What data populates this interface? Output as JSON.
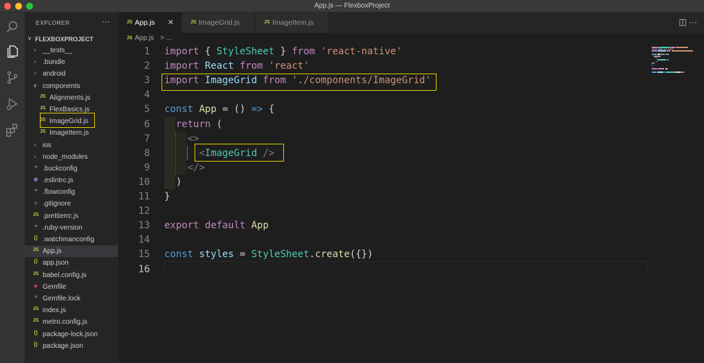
{
  "window": {
    "title": "App.js — FlexboxProject"
  },
  "sidebar": {
    "title": "EXPLORER",
    "more": "···",
    "project": "FLEXBOXPROJECT",
    "items": [
      {
        "label": "__tests__",
        "type": "folder",
        "expanded": false,
        "depth": 0,
        "icon": "chevron-right-icon"
      },
      {
        "label": ".bundle",
        "type": "folder",
        "expanded": false,
        "depth": 0,
        "icon": "chevron-right-icon"
      },
      {
        "label": "android",
        "type": "folder",
        "expanded": false,
        "depth": 0,
        "icon": "chevron-right-icon"
      },
      {
        "label": "components",
        "type": "folder",
        "expanded": true,
        "depth": 0,
        "icon": "chevron-down-icon"
      },
      {
        "label": "Alignments.js",
        "type": "file",
        "depth": 1,
        "badge": "JS",
        "badge_color": "#cbcb41"
      },
      {
        "label": "FlexBasics.js",
        "type": "file",
        "depth": 1,
        "badge": "JS",
        "badge_color": "#cbcb41"
      },
      {
        "label": "ImageGrid.js",
        "type": "file",
        "depth": 1,
        "badge": "JS",
        "badge_color": "#cbcb41"
      },
      {
        "label": "ImageItem.js",
        "type": "file",
        "depth": 1,
        "badge": "JS",
        "badge_color": "#cbcb41"
      },
      {
        "label": "ios",
        "type": "folder",
        "expanded": false,
        "depth": 0,
        "icon": "chevron-right-icon"
      },
      {
        "label": "node_modules",
        "type": "folder",
        "expanded": false,
        "depth": 0,
        "icon": "chevron-right-icon"
      },
      {
        "label": ".buckconfig",
        "type": "file",
        "depth": 0,
        "badge": "≡",
        "badge_color": "#9da5b4"
      },
      {
        "label": ".eslintrc.js",
        "type": "file",
        "depth": 0,
        "badge": "◉",
        "badge_color": "#a074c4"
      },
      {
        "label": ".flowconfig",
        "type": "file",
        "depth": 0,
        "badge": "≡",
        "badge_color": "#9da5b4"
      },
      {
        "label": ".gitignore",
        "type": "file",
        "depth": 0,
        "badge": "◆",
        "badge_color": "#41535b"
      },
      {
        "label": ".prettierrc.js",
        "type": "file",
        "depth": 0,
        "badge": "JS",
        "badge_color": "#cbcb41"
      },
      {
        "label": ".ruby-version",
        "type": "file",
        "depth": 0,
        "badge": "≡",
        "badge_color": "#9da5b4"
      },
      {
        "label": ".watchmanconfig",
        "type": "file",
        "depth": 0,
        "badge": "{}",
        "badge_color": "#cbcb41"
      },
      {
        "label": "App.js",
        "type": "file",
        "depth": 0,
        "badge": "JS",
        "badge_color": "#cbcb41",
        "active": true
      },
      {
        "label": "app.json",
        "type": "file",
        "depth": 0,
        "badge": "{}",
        "badge_color": "#cbcb41"
      },
      {
        "label": "babel.config.js",
        "type": "file",
        "depth": 0,
        "badge": "JS",
        "badge_color": "#cbcb41"
      },
      {
        "label": "Gemfile",
        "type": "file",
        "depth": 0,
        "badge": "◆",
        "badge_color": "#cc3e44"
      },
      {
        "label": "Gemfile.lock",
        "type": "file",
        "depth": 0,
        "badge": "≡",
        "badge_color": "#9da5b4"
      },
      {
        "label": "index.js",
        "type": "file",
        "depth": 0,
        "badge": "JS",
        "badge_color": "#cbcb41"
      },
      {
        "label": "metro.config.js",
        "type": "file",
        "depth": 0,
        "badge": "JS",
        "badge_color": "#cbcb41"
      },
      {
        "label": "package-lock.json",
        "type": "file",
        "depth": 0,
        "badge": "{}",
        "badge_color": "#cbcb41"
      },
      {
        "label": "package.json",
        "type": "file",
        "depth": 0,
        "badge": "{}",
        "badge_color": "#cbcb41"
      }
    ]
  },
  "tabs": [
    {
      "label": "App.js",
      "icon": "JS",
      "active": true,
      "close": "✕"
    },
    {
      "label": "ImageGrid.js",
      "icon": "JS",
      "active": false
    },
    {
      "label": "ImageItem.js",
      "icon": "JS",
      "active": false
    }
  ],
  "tab_actions": "◫  ···",
  "breadcrumb": {
    "icon": "JS",
    "file": "App.js",
    "sep": "> ..."
  },
  "editor": {
    "current_line": 16,
    "lines": [
      {
        "n": "1",
        "tokens": [
          [
            "kw",
            "import"
          ],
          [
            "pn",
            " { "
          ],
          [
            "cls",
            "StyleSheet"
          ],
          [
            "pn",
            " } "
          ],
          [
            "kw",
            "from"
          ],
          [
            "pn",
            " "
          ],
          [
            "str",
            "'react-native'"
          ]
        ]
      },
      {
        "n": "2",
        "tokens": [
          [
            "kw",
            "import"
          ],
          [
            "pn",
            " "
          ],
          [
            "vr",
            "React"
          ],
          [
            "pn",
            " "
          ],
          [
            "kw",
            "from"
          ],
          [
            "pn",
            " "
          ],
          [
            "str",
            "'react'"
          ]
        ]
      },
      {
        "n": "3",
        "tokens": [
          [
            "kw",
            "import"
          ],
          [
            "pn",
            " "
          ],
          [
            "vr",
            "ImageGrid"
          ],
          [
            "pn",
            " "
          ],
          [
            "kw",
            "from"
          ],
          [
            "pn",
            " "
          ],
          [
            "str",
            "'./components/ImageGrid'"
          ]
        ]
      },
      {
        "n": "4",
        "tokens": []
      },
      {
        "n": "5",
        "tokens": [
          [
            "kwb",
            "const"
          ],
          [
            "pn",
            " "
          ],
          [
            "fn",
            "App"
          ],
          [
            "pn",
            " = () "
          ],
          [
            "kwb",
            "=>"
          ],
          [
            "pn",
            " {"
          ]
        ]
      },
      {
        "n": "6",
        "tokens": [
          [
            "pn",
            "  "
          ],
          [
            "kw",
            "return"
          ],
          [
            "pn",
            " ("
          ]
        ]
      },
      {
        "n": "7",
        "tokens": [
          [
            "pn",
            "    "
          ],
          [
            "tag",
            "<>"
          ]
        ]
      },
      {
        "n": "8",
        "tokens": [
          [
            "pn",
            "      "
          ],
          [
            "tag",
            "<"
          ],
          [
            "cls",
            "ImageGrid"
          ],
          [
            "pn",
            " "
          ],
          [
            "tag",
            "/>"
          ]
        ]
      },
      {
        "n": "9",
        "tokens": [
          [
            "pn",
            "    "
          ],
          [
            "tag",
            "</>"
          ]
        ]
      },
      {
        "n": "10",
        "tokens": [
          [
            "pn",
            "  )"
          ]
        ]
      },
      {
        "n": "11",
        "tokens": [
          [
            "pn",
            "}"
          ]
        ]
      },
      {
        "n": "12",
        "tokens": []
      },
      {
        "n": "13",
        "tokens": [
          [
            "kw",
            "export"
          ],
          [
            "pn",
            " "
          ],
          [
            "kw",
            "default"
          ],
          [
            "pn",
            " "
          ],
          [
            "fn",
            "App"
          ]
        ]
      },
      {
        "n": "14",
        "tokens": []
      },
      {
        "n": "15",
        "tokens": [
          [
            "kwb",
            "const"
          ],
          [
            "pn",
            " "
          ],
          [
            "vr",
            "styles"
          ],
          [
            "pn",
            " = "
          ],
          [
            "cls",
            "StyleSheet"
          ],
          [
            "pn",
            "."
          ],
          [
            "fn",
            "create"
          ],
          [
            "pn",
            "({})"
          ]
        ]
      },
      {
        "n": "16",
        "tokens": []
      }
    ]
  },
  "colors": {
    "highlight_box": "#e2d000",
    "keyword": "#c586c0",
    "keyword_blue": "#569cd6",
    "string": "#ce9178",
    "class": "#4ec9b0",
    "variable": "#9cdcfe",
    "function": "#dcdcaa"
  }
}
